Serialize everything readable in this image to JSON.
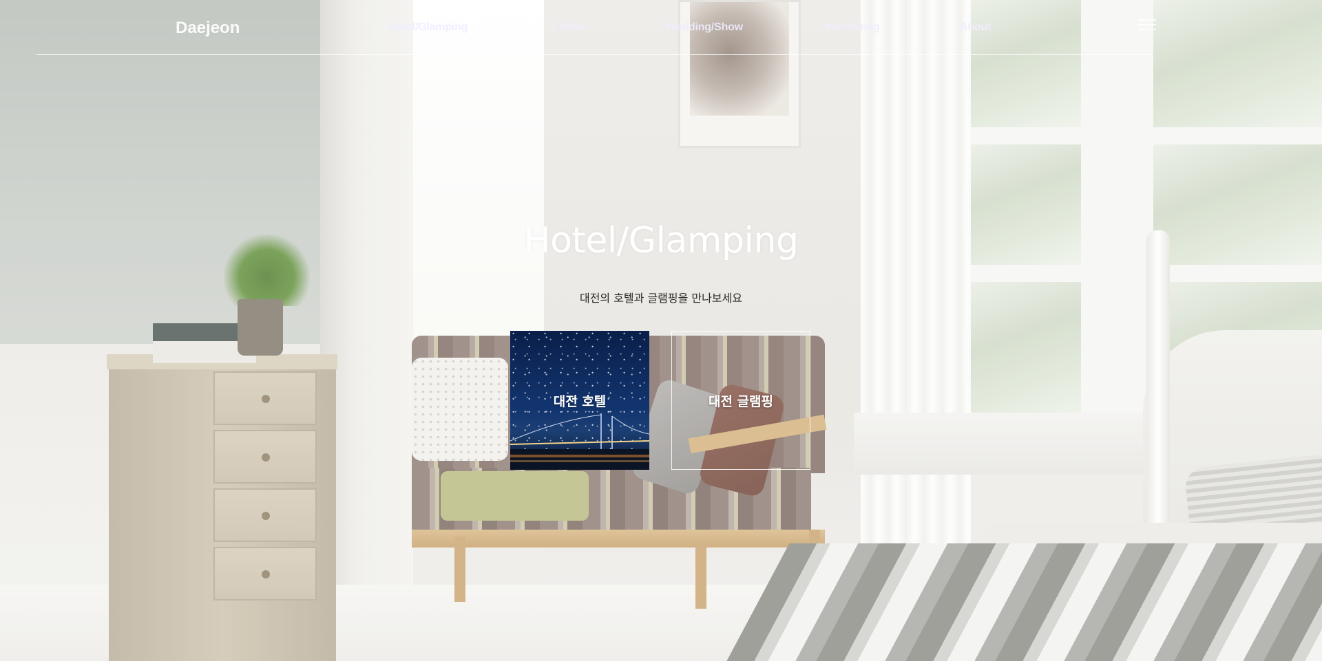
{
  "header": {
    "logo": "Daejeon",
    "nav": [
      {
        "label": "Hotel/Glamping"
      },
      {
        "label": "Coffee"
      },
      {
        "label": "Wedding/Show"
      },
      {
        "label": "Interesting"
      },
      {
        "label": "About"
      }
    ],
    "menu_icon": "hamburger-icon"
  },
  "hero": {
    "title": "Hotel/Glamping",
    "subtitle": "대전의 호텔과 글램핑을 만나보세요",
    "cards": [
      {
        "label": "대전 호텔",
        "image": "night-bridge-photo"
      },
      {
        "label": "대전 글램핑"
      }
    ]
  },
  "colors": {
    "nav_text": "#f0ecff",
    "title_text": "#ffffff",
    "subtitle_text": "#2c2a27",
    "card_hotel_bg": "#12346e"
  }
}
